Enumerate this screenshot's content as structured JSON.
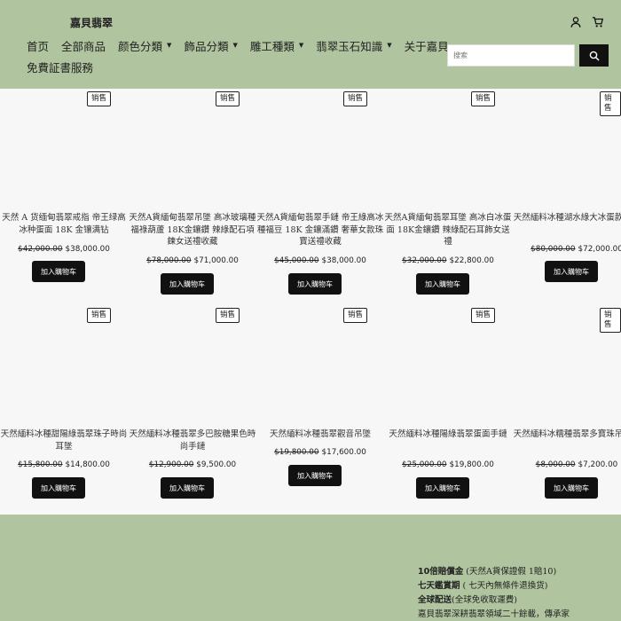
{
  "header": {
    "brand": "嘉貝翡翠",
    "account_icon": "user-icon",
    "cart_icon": "cart-icon",
    "nav": [
      {
        "label": "首页",
        "dropdown": false
      },
      {
        "label": "全部商品",
        "dropdown": false
      },
      {
        "label": "颜色分類",
        "dropdown": true
      },
      {
        "label": "飾品分類",
        "dropdown": true
      },
      {
        "label": "雕工種類",
        "dropdown": true
      },
      {
        "label": "翡翠玉石知識",
        "dropdown": true
      },
      {
        "label": "关于嘉貝",
        "dropdown": false
      },
      {
        "label": "免費証書服務",
        "dropdown": false
      }
    ],
    "search_placeholder": "搜索",
    "search_icon": "search-icon"
  },
  "products": [
    {
      "badge": "销售",
      "title": "天然 A 货缅甸翡翠戒指 帝王绿高冰种蛋面 18K 金镶满钻",
      "old_price": "$42,000.00",
      "price": "$38,000.00",
      "cta": "加入購物车"
    },
    {
      "badge": "销售",
      "title": "天然A貨緬甸翡翠吊墜 高冰玻璃種福祿葫蘆 18K金鑲鑽 辣綠配石項鍊女送禮收藏",
      "old_price": "$78,000.00",
      "price": "$71,000.00",
      "cta": "加入購物车"
    },
    {
      "badge": "销售",
      "title": "天然A貨緬甸翡翠手鏈 帝王綠高冰種福豆 18K 金鑲滿鑽 奢華女款珠寶送禮收藏",
      "old_price": "$45,000.00",
      "price": "$38,000.00",
      "cta": "加入購物车"
    },
    {
      "badge": "销售",
      "title": "天然A貨緬甸翡翠耳墜 高冰白冰蛋面 18K金鑲鑽 辣綠配石耳飾女送禮",
      "old_price": "$32,000.00",
      "price": "$22,800.00",
      "cta": "加入購物车"
    },
    {
      "badge": "销售",
      "title": "天然緬料冰種湖水綠大冰蛋款吊墜",
      "old_price": "$80,000.00",
      "price": "$72,000.00",
      "cta": "加入購物车"
    },
    {
      "badge": "销售",
      "title": "天然緬料冰種甜陽綠翡翠珠子時尚耳墜",
      "old_price": "$15,800.00",
      "price": "$14,800.00",
      "cta": "加入購物车"
    },
    {
      "badge": "销售",
      "title": "天然緬料冰種翡翠多巴胺糖果色時尚手鏈",
      "old_price": "$12,900.00",
      "price": "$9,500.00",
      "cta": "加入購物车"
    },
    {
      "badge": "销售",
      "title": "天然緬料冰種翡翠觀音吊墜",
      "old_price": "$19,800.00",
      "price": "$17,600.00",
      "cta": "加入購物车"
    },
    {
      "badge": "销售",
      "title": "天然緬料冰種陽綠翡翠蛋面手鏈",
      "old_price": "$25,000.00",
      "price": "$19,800.00",
      "cta": "加入購物车"
    },
    {
      "badge": "销售",
      "title": "天然緬料冰糯種翡翠多寶珠吊項鏈",
      "old_price": "$8,000.00",
      "price": "$7,200.00",
      "cta": "加入購物车"
    }
  ],
  "footer": {
    "line1_bold": "10倍賠償金",
    "line1_rest": " (天然A貨保證假 1賠10)",
    "line2_bold": "七天鑑賞期",
    "line2_rest": " ( 七天內無條件退換货)",
    "line3_bold": "全球配送",
    "line3_rest": "(全球免收取運費)",
    "line4": "嘉貝翡翠深耕翡翠領域二十餘載，傳承家"
  }
}
